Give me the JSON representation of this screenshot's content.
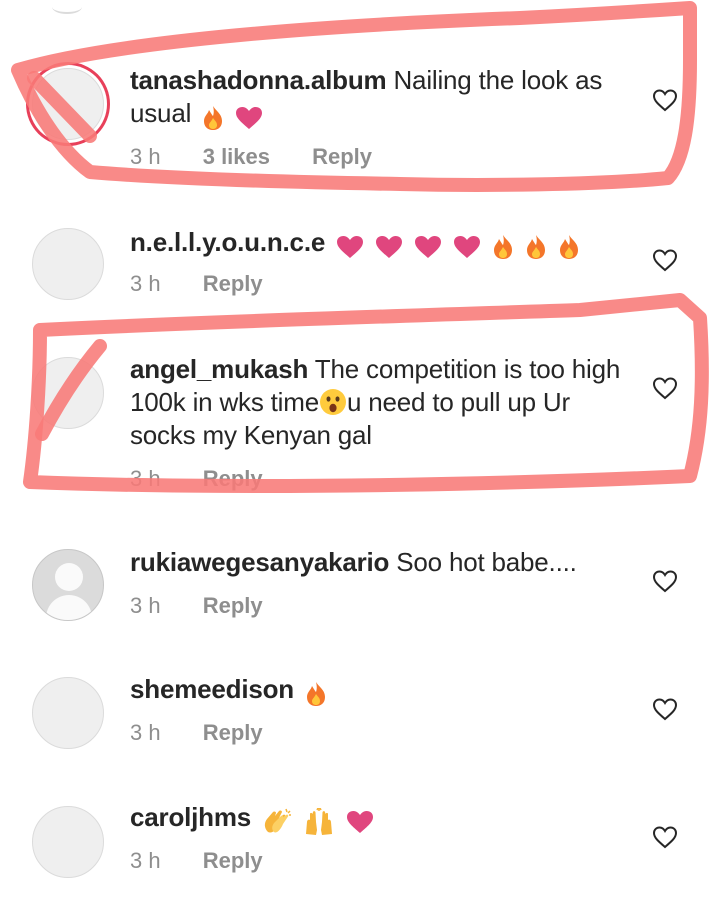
{
  "comments": [
    {
      "username": "tanashadonna.album",
      "text": "Nailing the look as usual",
      "time": "3 h",
      "likes": "3 likes",
      "reply": "Reply",
      "emoji": [
        "fire-emoji",
        "heart-emoji"
      ]
    },
    {
      "username": "n.e.l.l.y.o.u.n.c.e",
      "text": "",
      "time": "3 h",
      "reply": "Reply",
      "emoji": [
        "heart-emoji",
        "heart-emoji",
        "heart-emoji",
        "heart-emoji",
        "fire-emoji",
        "fire-emoji",
        "fire-emoji"
      ]
    },
    {
      "username": "angel_mukash",
      "text_before": "The competition is too high 100k in wks time",
      "text_after": "u need to pull up Ur socks my Kenyan gal",
      "time": "3 h",
      "reply": "Reply",
      "emoji": [
        "surprised-face-emoji"
      ]
    },
    {
      "username": "rukiawegesanyakario",
      "text": "Soo hot babe....",
      "time": "3 h",
      "reply": "Reply",
      "emoji": []
    },
    {
      "username": "shemeedison",
      "text": "",
      "time": "3 h",
      "reply": "Reply",
      "emoji": [
        "fire-emoji"
      ]
    },
    {
      "username": "caroljhms",
      "text": "",
      "time": "3 h",
      "reply": "Reply",
      "emoji": [
        "clapping-hands-emoji",
        "raising-hands-emoji",
        "heart-emoji"
      ]
    }
  ],
  "colors": {
    "username": "#262626",
    "meta": "#8e8e8e",
    "highlight_marker": "#f87a78",
    "heart_emoji": "#e0467e",
    "fire_emoji": "#f4762a"
  }
}
